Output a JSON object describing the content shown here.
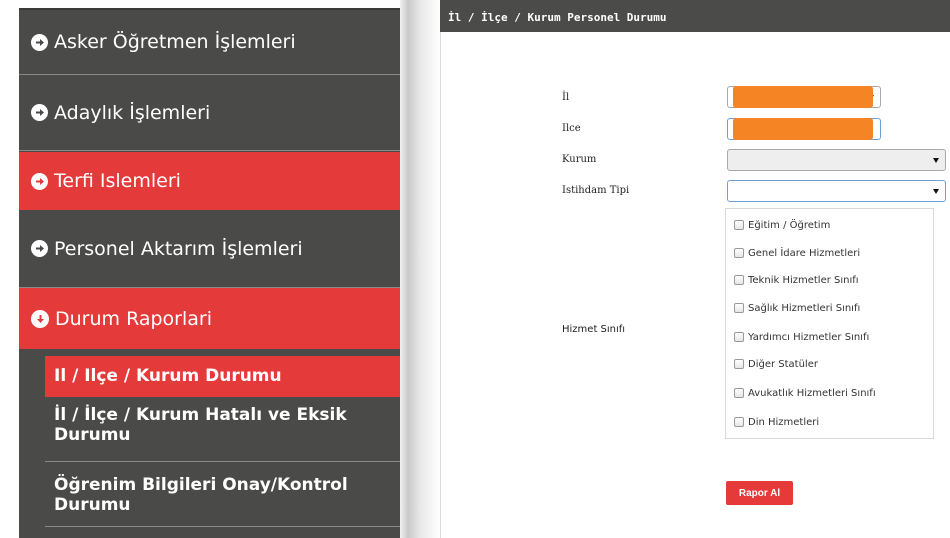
{
  "sidebar": {
    "items": [
      {
        "label": "Asker Öğretmen İşlemleri"
      },
      {
        "label": "Adaylık İşlemleri"
      },
      {
        "label": "Terfi Islemleri"
      },
      {
        "label": "Personel Aktarım İşlemleri"
      },
      {
        "label": "Durum Raporlari"
      }
    ],
    "sub_items": [
      {
        "label": "Il / Ilçe / Kurum Durumu"
      },
      {
        "label_line1": "İl / İlçe / Kurum Hatalı ve Eksik",
        "label_line2": "Durumu"
      },
      {
        "label_line1": "Öğrenim Bilgileri Onay/Kontrol",
        "label_line2": "Durumu"
      }
    ]
  },
  "panel": {
    "title": "İl / İlçe / Kurum Personel Durumu",
    "labels": {
      "il": "İl",
      "ilce": "Ilce",
      "kurum": "Kurum",
      "istihdam": "Istihdam Tipi",
      "hizmet": "Hizmet Sınıfı"
    },
    "hizmet_options": [
      "Eğitim / Öğretim",
      "Genel İdare Hizmetleri",
      "Teknik Hizmetler Sınıfı",
      "Sağlık Hizmetleri Sınıfı",
      "Yardımcı Hizmetler Sınıfı",
      "Diğer Statüler",
      "Avukatlık Hizmetleri Sınıfı",
      "Din Hizmetleri"
    ],
    "report_button": "Rapor Al"
  },
  "colors": {
    "accent_red": "#e53a3a",
    "sidebar_bg": "#4a4a48",
    "redaction": "#f58424"
  }
}
